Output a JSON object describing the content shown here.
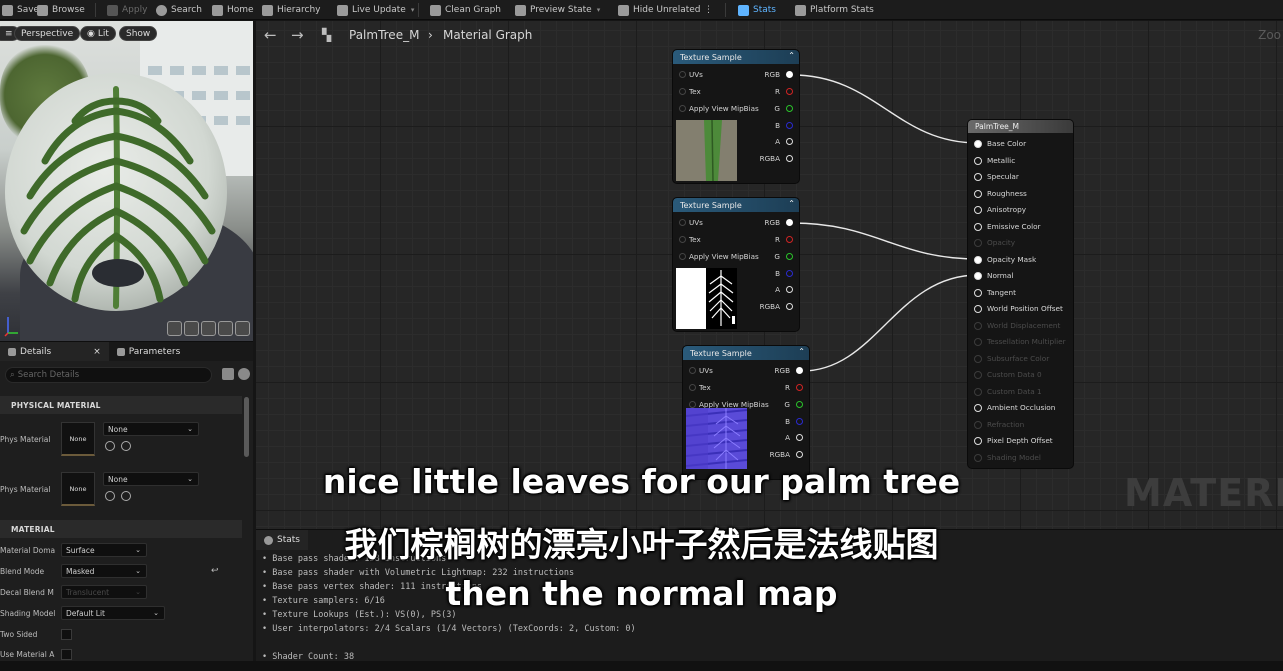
{
  "toolbar": {
    "items": [
      "Save",
      "Browse",
      "Apply",
      "Search",
      "Home",
      "Hierarchy",
      "Live Update",
      "Clean Graph",
      "Preview State",
      "Hide Unrelated",
      "Stats",
      "Platform Stats"
    ]
  },
  "viewport": {
    "buttons": [
      "Perspective",
      "Lit",
      "Show"
    ]
  },
  "details": {
    "tabs": [
      "Details",
      "Parameters"
    ],
    "search_placeholder": "Search Details",
    "physical_section": "PHYSICAL MATERIAL",
    "phys_rows": [
      {
        "label": "Phys Material",
        "thumb": "None",
        "value": "None"
      },
      {
        "label": "Phys Material",
        "thumb": "None",
        "value": "None"
      }
    ],
    "material_section": "MATERIAL",
    "props": [
      {
        "label": "Material Doma",
        "value": "Surface"
      },
      {
        "label": "Blend Mode",
        "value": "Masked"
      },
      {
        "label": "Decal Blend M",
        "value": "Translucent"
      },
      {
        "label": "Shading Model",
        "value": "Default Lit"
      },
      {
        "label": "Two Sided",
        "value": ""
      },
      {
        "label": "Use Material A",
        "value": ""
      }
    ]
  },
  "graph": {
    "breadcrumb_asset": "PalmTree_M",
    "breadcrumb_page": "Material Graph",
    "zoom": "Zoo",
    "watermark": "MATERIA",
    "texture_nodes": [
      {
        "title": "Texture Sample",
        "inputs": [
          "UVs",
          "Tex",
          "Apply View MipBias"
        ],
        "outputs": [
          "RGB",
          "R",
          "G",
          "B",
          "A",
          "RGBA"
        ]
      },
      {
        "title": "Texture Sample",
        "inputs": [
          "UVs",
          "Tex",
          "Apply View MipBias"
        ],
        "outputs": [
          "RGB",
          "R",
          "G",
          "B",
          "A",
          "RGBA"
        ]
      },
      {
        "title": "Texture Sample",
        "inputs": [
          "UVs",
          "Tex",
          "Apply View MipBias"
        ],
        "outputs": [
          "RGB",
          "R",
          "G",
          "B",
          "A",
          "RGBA"
        ]
      }
    ],
    "material_node": {
      "title": "PalmTree_M",
      "pins": [
        {
          "label": "Base Color",
          "enabled": true,
          "connected": true
        },
        {
          "label": "Metallic",
          "enabled": true
        },
        {
          "label": "Specular",
          "enabled": true
        },
        {
          "label": "Roughness",
          "enabled": true
        },
        {
          "label": "Anisotropy",
          "enabled": true
        },
        {
          "label": "Emissive Color",
          "enabled": true
        },
        {
          "label": "Opacity",
          "enabled": false
        },
        {
          "label": "Opacity Mask",
          "enabled": true,
          "connected": true
        },
        {
          "label": "Normal",
          "enabled": true,
          "connected": true
        },
        {
          "label": "Tangent",
          "enabled": true
        },
        {
          "label": "World Position Offset",
          "enabled": true
        },
        {
          "label": "World Displacement",
          "enabled": false
        },
        {
          "label": "Tessellation Multiplier",
          "enabled": false
        },
        {
          "label": "Subsurface Color",
          "enabled": false
        },
        {
          "label": "Custom Data 0",
          "enabled": false
        },
        {
          "label": "Custom Data 1",
          "enabled": false
        },
        {
          "label": "Ambient Occlusion",
          "enabled": true
        },
        {
          "label": "Refraction",
          "enabled": false
        },
        {
          "label": "Pixel Depth Offset",
          "enabled": true
        },
        {
          "label": "Shading Model",
          "enabled": false
        }
      ]
    }
  },
  "stats": {
    "tab": "Stats",
    "lines": [
      "• Base pass shader: 158 instructions",
      "• Base pass shader with Volumetric Lightmap: 232 instructions",
      "• Base pass vertex shader: 111 instructions",
      "• Texture samplers: 6/16",
      "• Texture Lookups (Est.): VS(0), PS(3)",
      "• User interpolators: 2/4 Scalars (1/4 Vectors) (TexCoords: 2, Custom: 0)",
      "",
      "• Shader Count: 38"
    ]
  },
  "subtitles": {
    "line1": "nice little leaves for our palm tree",
    "line2": "我们棕榈树的漂亮小叶子然后是法线贴图",
    "line3": "then the normal map"
  },
  "colors": {
    "node_header": "#2a5a7a",
    "material_header": "#5a5a5a",
    "stats_accent": "#5fb4ff"
  }
}
